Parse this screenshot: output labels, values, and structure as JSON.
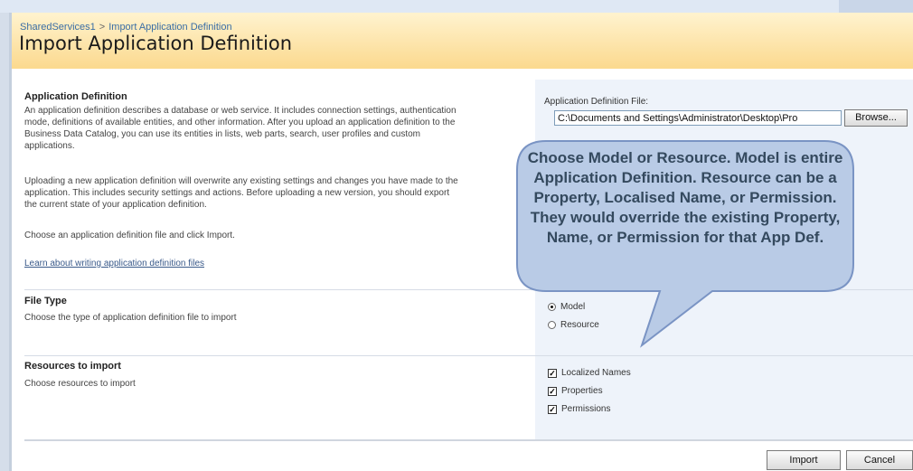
{
  "header": {
    "breadcrumb": [
      "SharedServices1",
      "Import Application Definition"
    ],
    "breadcrumb_sep": ">",
    "title": "Import Application Definition"
  },
  "sections": {
    "app_def": {
      "title": "Application Definition",
      "desc1": "An application definition describes a database or web service. It includes connection settings, authentication mode, definitions of available entities, and other information. After you upload an application definition to the Business Data Catalog, you can use its entities in lists, web parts, search, user profiles and custom applications.",
      "desc2": "Uploading a new application definition will overwrite any existing settings and changes you have made to the application. This includes security settings and actions. Before uploading a new version, you should export the current state of your application definition.",
      "desc3": "Choose an application definition file and click Import.",
      "link": "Learn about writing application definition files",
      "field_label": "Application Definition File:",
      "file_value": "C:\\Documents and Settings\\Administrator\\Desktop\\Pro",
      "browse_label": "Browse..."
    },
    "file_type": {
      "title": "File Type",
      "desc": "Choose the type of application definition file to import",
      "options": [
        "Model",
        "Resource"
      ],
      "selected": "Model"
    },
    "resources": {
      "title": "Resources to import",
      "desc": "Choose resources to import",
      "options": [
        "Localized Names",
        "Properties",
        "Permissions"
      ],
      "checked": [
        true,
        true,
        true
      ]
    }
  },
  "footer": {
    "import_label": "Import",
    "cancel_label": "Cancel"
  },
  "callout": {
    "text": "Choose Model or Resource. Model is entire Application Definition. Resource can be a Property, Localised Name, or Permission. They would override the existing Property, Name, or Permission for that App Def.",
    "fill": "#b9cbe6",
    "stroke": "#7a94c4"
  }
}
